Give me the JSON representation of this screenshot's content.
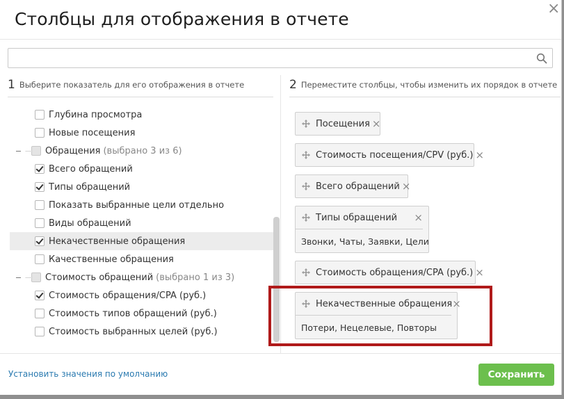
{
  "dialog": {
    "title": "Столбцы для отображения в отчете",
    "close_glyph": "×"
  },
  "search": {
    "value": "",
    "placeholder": "",
    "icon": "search-icon"
  },
  "left": {
    "step": "1",
    "heading": "Выберите показатель для его отображения в отчете",
    "items": [
      {
        "label": "Глубина просмотра",
        "checked": false,
        "level": 2
      },
      {
        "label": "Новые посещения",
        "checked": false,
        "level": 2
      },
      {
        "label": "Обращения",
        "extra": "(выбрано 3 из 6)",
        "group": true,
        "level": 1
      },
      {
        "label": "Всего обращений",
        "checked": true,
        "level": 2
      },
      {
        "label": "Типы обращений",
        "checked": true,
        "level": 2
      },
      {
        "label": "Показать выбранные цели отдельно",
        "checked": false,
        "level": 2
      },
      {
        "label": "Виды обращений",
        "checked": false,
        "level": 2
      },
      {
        "label": "Некачественные обращения",
        "checked": true,
        "level": 2,
        "highlight": true
      },
      {
        "label": "Качественные обращения",
        "checked": false,
        "level": 2
      },
      {
        "label": "Стоимость обращений",
        "extra": "(выбрано 1 из 3)",
        "group": true,
        "level": 1
      },
      {
        "label": "Стоимость обращения/CPA (руб.)",
        "checked": true,
        "level": 2
      },
      {
        "label": "Стоимость типов обращений (руб.)",
        "checked": false,
        "level": 2
      },
      {
        "label": "Стоимость выбранных целей (руб.)",
        "checked": false,
        "level": 2
      }
    ]
  },
  "right": {
    "step": "2",
    "heading": "Переместите столбцы, чтобы изменить их порядок в отчете",
    "chips": [
      {
        "label": "Посещения"
      },
      {
        "label": "Стоимость посещения/CPV (руб.)"
      },
      {
        "label": "Всего обращений"
      },
      {
        "label": "Типы обращений",
        "sub": "Звонки, Чаты, Заявки, Цели"
      },
      {
        "label": "Стоимость обращения/CPA (руб.)"
      },
      {
        "label": "Некачественные обращения",
        "sub": "Потери, Нецелевые, Повторы",
        "highlighted": true
      }
    ]
  },
  "footer": {
    "reset_label": "Установить значения по умолчанию",
    "save_label": "Сохранить"
  },
  "colors": {
    "accent_green": "#6cbf4d",
    "link_blue": "#2a7ab0",
    "highlight_red": "#b01a1a"
  }
}
